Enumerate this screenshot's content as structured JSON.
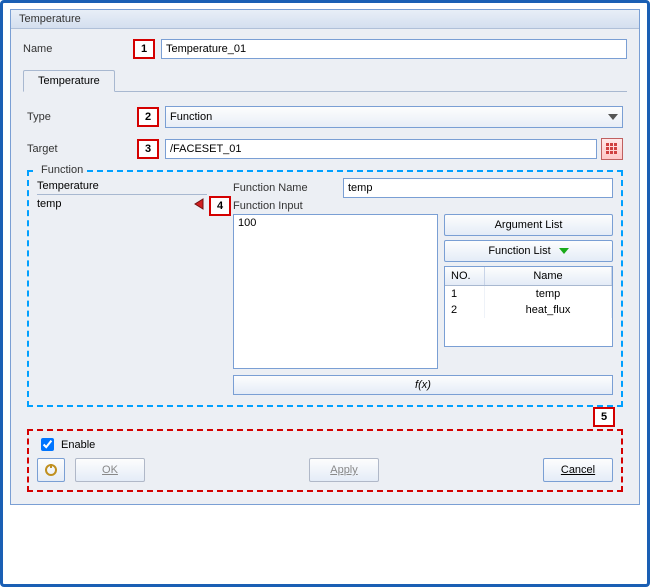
{
  "window": {
    "title": "Temperature"
  },
  "name": {
    "label": "Name",
    "value": "Temperature_01"
  },
  "tab": {
    "label": "Temperature"
  },
  "type": {
    "label": "Type",
    "value": "Function"
  },
  "target": {
    "label": "Target",
    "value": "/FACESET_01"
  },
  "function": {
    "group_label": "Function",
    "left_header": "Temperature",
    "left_item": "temp",
    "fn_name_label": "Function Name",
    "fn_name_value": "temp",
    "fn_input_label": "Function Input",
    "fn_input_value": "100",
    "arg_btn": "Argument List",
    "list_btn": "Function List",
    "table": {
      "col_no": "NO.",
      "col_name": "Name",
      "rows": [
        {
          "no": "1",
          "name": "temp"
        },
        {
          "no": "2",
          "name": "heat_flux"
        }
      ]
    },
    "fx_label": "f(x)"
  },
  "bottom": {
    "enable_label": "Enable",
    "ok": "OK",
    "apply": "Apply",
    "cancel": "Cancel"
  },
  "markers": {
    "m1": "1",
    "m2": "2",
    "m3": "3",
    "m4": "4",
    "m5": "5"
  }
}
